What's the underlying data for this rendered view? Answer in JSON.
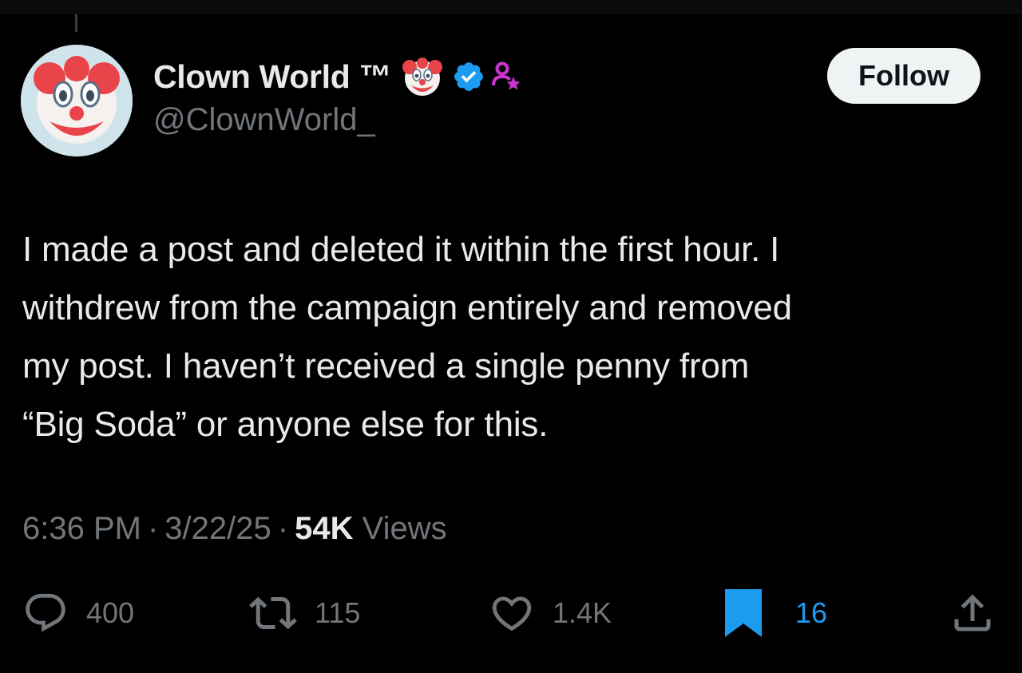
{
  "author": {
    "display_name": "Clown World ™",
    "handle": "@ClownWorld_",
    "avatar_icon": "clown-face-icon",
    "name_emoji_icon": "clown-face-icon",
    "verified_icon": "verified-badge-icon",
    "affiliate_icon": "affiliate-badge-icon",
    "verified_color": "#1d9bf0",
    "affiliate_color": "#c936cf"
  },
  "follow_button": {
    "label": "Follow"
  },
  "tweet": {
    "lines": [
      "I made a post and deleted it within the first hour. I",
      "withdrew from the campaign entirely and removed",
      "my post. I haven’t received a single penny from",
      "“Big Soda” or anyone else for this."
    ]
  },
  "meta": {
    "time": "6:36 PM",
    "separator": "·",
    "date": "3/22/25",
    "views_count": "54K",
    "views_label": "Views"
  },
  "actions": {
    "reply": {
      "icon": "reply-icon",
      "count": "400"
    },
    "retweet": {
      "icon": "retweet-icon",
      "count": "115"
    },
    "like": {
      "icon": "heart-icon",
      "count": "1.4K"
    },
    "bookmark": {
      "icon": "bookmark-icon",
      "count": "16",
      "color": "#1d9bf0"
    },
    "share": {
      "icon": "share-icon"
    }
  },
  "colors": {
    "background": "#000000",
    "primary_text": "#e7e9ea",
    "secondary_text": "#71767b",
    "accent": "#1d9bf0"
  }
}
